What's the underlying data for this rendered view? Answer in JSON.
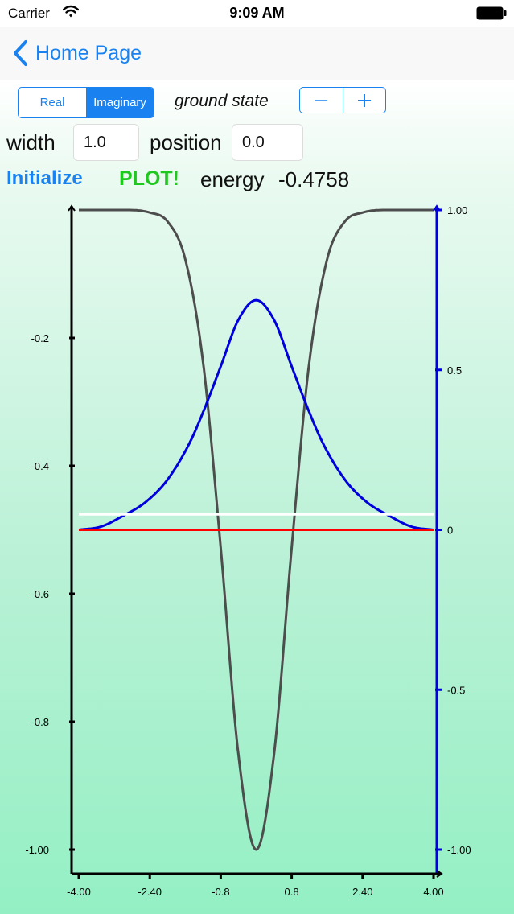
{
  "status_bar": {
    "carrier": "Carrier",
    "time": "9:09 AM"
  },
  "nav": {
    "back_label": "Home Page"
  },
  "controls": {
    "segments": [
      {
        "label": "Real",
        "active": false
      },
      {
        "label": "Imaginary",
        "active": true
      }
    ],
    "state_label": "ground state",
    "width_label": "width",
    "width_value": "1.0",
    "position_label": "position",
    "position_value": "0.0",
    "initialize_label": "Initialize",
    "plot_label": "PLOT!",
    "energy_label": "energy",
    "energy_value": "-0.4758"
  },
  "colors": {
    "accent": "#1a82f0",
    "plot_button": "#1ec81e",
    "potential": "#4d4d4d",
    "wavefunction": "#0000dd",
    "baseline": "#ff0000",
    "energy_line": "#ffffff",
    "right_axis": "#0000dd"
  },
  "chart_data": {
    "type": "line",
    "x_range": [
      -4,
      4
    ],
    "x_ticks": [
      "-4.00",
      "-2.40",
      "-0.8",
      "0.8",
      "2.40",
      "4.00"
    ],
    "left_axis": {
      "ylim": [
        -1.0,
        0.0
      ],
      "ticks": [
        "-0.2",
        "-0.4",
        "-0.6",
        "-0.8",
        "-1.00"
      ]
    },
    "right_axis": {
      "ylim": [
        -1.0,
        1.0
      ],
      "ticks": [
        "1.00",
        "0.5",
        "0",
        "-0.5",
        "-1.00"
      ]
    },
    "series": [
      {
        "axis": "left",
        "color": "#4d4d4d",
        "x": [
          -4.0,
          -3.0,
          -2.4,
          -2.0,
          -1.6,
          -1.2,
          -0.8,
          -0.4,
          0.0,
          0.4,
          0.8,
          1.2,
          1.6,
          2.0,
          2.4,
          3.0,
          4.0
        ],
        "y": [
          0.0,
          0.0,
          -0.004,
          -0.018,
          -0.077,
          -0.237,
          -0.528,
          -0.852,
          -1.0,
          -0.852,
          -0.528,
          -0.237,
          -0.077,
          -0.018,
          -0.004,
          0.0,
          0.0
        ]
      },
      {
        "axis": "right",
        "color": "#0000dd",
        "x": [
          -4.0,
          -3.5,
          -3.0,
          -2.5,
          -2.0,
          -1.5,
          -1.2,
          -0.8,
          -0.4,
          0.0,
          0.4,
          0.8,
          1.2,
          1.5,
          2.0,
          2.5,
          3.0,
          3.5,
          4.0
        ],
        "y": [
          0.0,
          0.01,
          0.044,
          0.086,
          0.157,
          0.272,
          0.367,
          0.511,
          0.657,
          0.718,
          0.657,
          0.511,
          0.367,
          0.272,
          0.157,
          0.086,
          0.044,
          0.01,
          0.0
        ]
      },
      {
        "axis": "right",
        "color": "#ff0000",
        "x": [
          -4.0,
          4.0
        ],
        "y": [
          0.0,
          0.0
        ]
      },
      {
        "axis": "left",
        "color": "#ffffff",
        "x": [
          -4.0,
          4.0
        ],
        "y": [
          -0.4758,
          -0.4758
        ]
      }
    ]
  }
}
